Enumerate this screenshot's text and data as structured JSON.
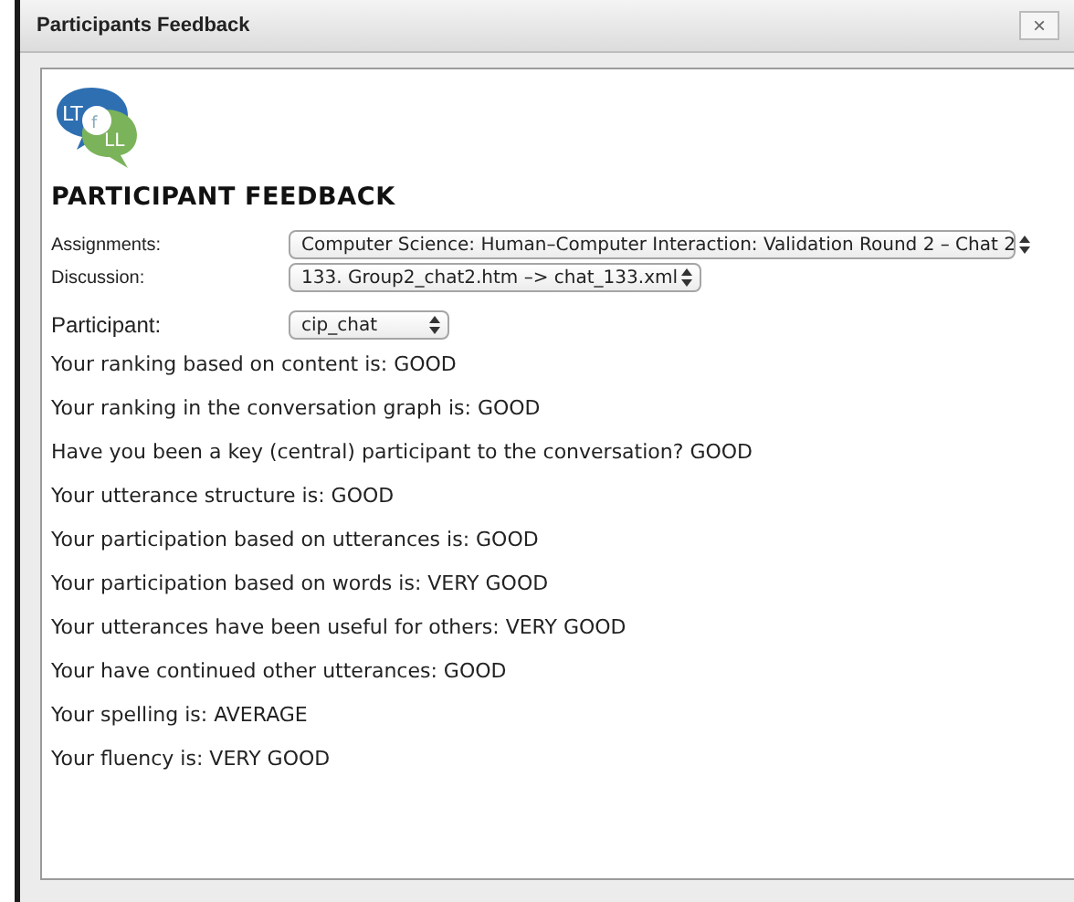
{
  "window": {
    "title": "Participants Feedback",
    "close": "×"
  },
  "logo": {
    "left": "LT",
    "middle": "f",
    "right": "LL"
  },
  "heading": "PARTICIPANT FEEDBACK",
  "fields": [
    {
      "label": "Assignments:",
      "value": "Computer Science: Human–Computer Interaction: Validation Round 2 – Chat 2",
      "kind": "wide"
    },
    {
      "label": "Discussion:",
      "value": "133. Group2_chat2.htm –> chat_133.xml",
      "kind": "medium"
    },
    {
      "label": "Participant:",
      "value": "cip_chat",
      "kind": "small"
    }
  ],
  "feedback": [
    "Your ranking based on content is: GOOD",
    "Your ranking in the conversation graph is: GOOD",
    "Have you been a key (central) participant to the conversation? GOOD",
    "Your utterance structure is: GOOD",
    "Your participation based on utterances is: GOOD",
    "Your participation based on words is: VERY GOOD",
    "Your utterances have been useful for others: VERY GOOD",
    "Your have continued other utterances: GOOD",
    "Your spelling is: AVERAGE",
    "Your fluency is: VERY GOOD"
  ]
}
